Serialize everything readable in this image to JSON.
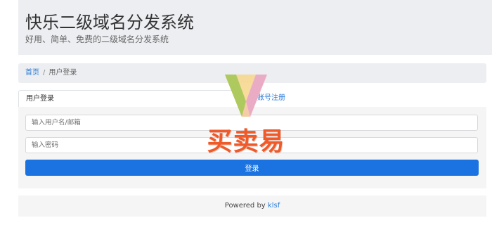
{
  "header": {
    "title": "快乐二级域名分发系统",
    "subtitle": "好用、简单、免费的二级域名分发系统"
  },
  "breadcrumb": {
    "home": "首页",
    "separator": "/",
    "current": "用户登录"
  },
  "tabs": [
    {
      "label": "用户登录",
      "active": true
    },
    {
      "label": "账号注册",
      "active": false
    }
  ],
  "form": {
    "username_placeholder": "输入用户名/邮箱",
    "password_placeholder": "输入密码",
    "submit_label": "登录"
  },
  "footer": {
    "prefix": "Powered by",
    "link": "klsf"
  },
  "watermark": {
    "text": "买卖易"
  },
  "colors": {
    "accent": "#1a73e0",
    "link": "#2a7ad6",
    "panel_bg": "#f5f5f5",
    "header_bg": "#eceef1",
    "watermark": "#f05a28"
  }
}
